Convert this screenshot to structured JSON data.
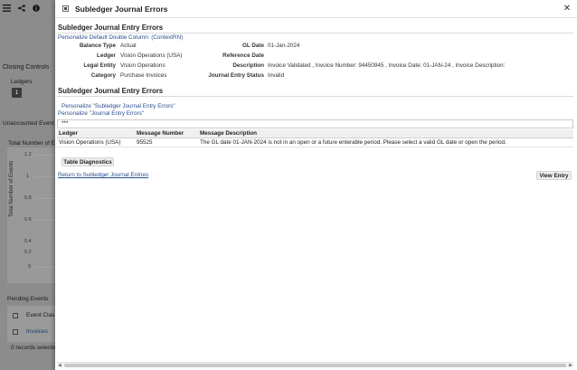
{
  "background": {
    "closing_controls": "Closing Controls",
    "ledgers_label": "Ledgers",
    "ledgers_count": "1",
    "unaccounted_events": "Unaccounted Event",
    "total_number_of": "Total Number of E",
    "y_axis_label": "Total Number of Events",
    "y_ticks": [
      "1.2",
      "1",
      "0.8",
      "0.6",
      "0.4",
      "0.2",
      "0"
    ],
    "pending_events": "Pending Events",
    "event_class": "Event Clas",
    "invoices": "Invoices",
    "records_selected": "0 records selecte"
  },
  "dialog": {
    "title": "Subledger Journal Errors",
    "section1_title": "Subledger Journal Entry Errors",
    "personalize_double_column": "Personalize Default Double Column: (ContextRN)",
    "fields_left": [
      {
        "label": "Balance Type",
        "value": "Actual"
      },
      {
        "label": "Ledger",
        "value": "Vision Operations (USA)"
      },
      {
        "label": "Legal Entity",
        "value": "Vision Operations"
      },
      {
        "label": "Category",
        "value": "Purchase Invoices"
      }
    ],
    "fields_right": [
      {
        "label": "GL Date",
        "value": "01-Jan-2024"
      },
      {
        "label": "Reference Date",
        "value": ""
      },
      {
        "label": "Description",
        "value": "Invoice Validated , Invoice Number: 94450945 , Invoice Date: 01-JAN-24 , Invoice Description:"
      },
      {
        "label": "Journal Entry Status",
        "value": "Invalid"
      }
    ],
    "section2_title": "Subledger Journal Entry Errors",
    "personalize_links": [
      "Personalize \"Subledger Journal Entry Errors\"",
      "Personalize \"Journal Entry Errors\""
    ],
    "table_toolbar": "***",
    "table": {
      "headers": [
        "Ledger",
        "Message Number",
        "Message Description"
      ],
      "rows": [
        [
          "Vision Operations (USA)",
          "95525",
          "The GL date 01-JAN-2024 is not in an open or a future enterable period. Please select a valid GL date or open the period."
        ]
      ]
    },
    "table_diagnostics_button": "Table Diagnostics",
    "return_link": "Return to Subledger Journal Entries",
    "view_entry_button": "View Entry"
  }
}
